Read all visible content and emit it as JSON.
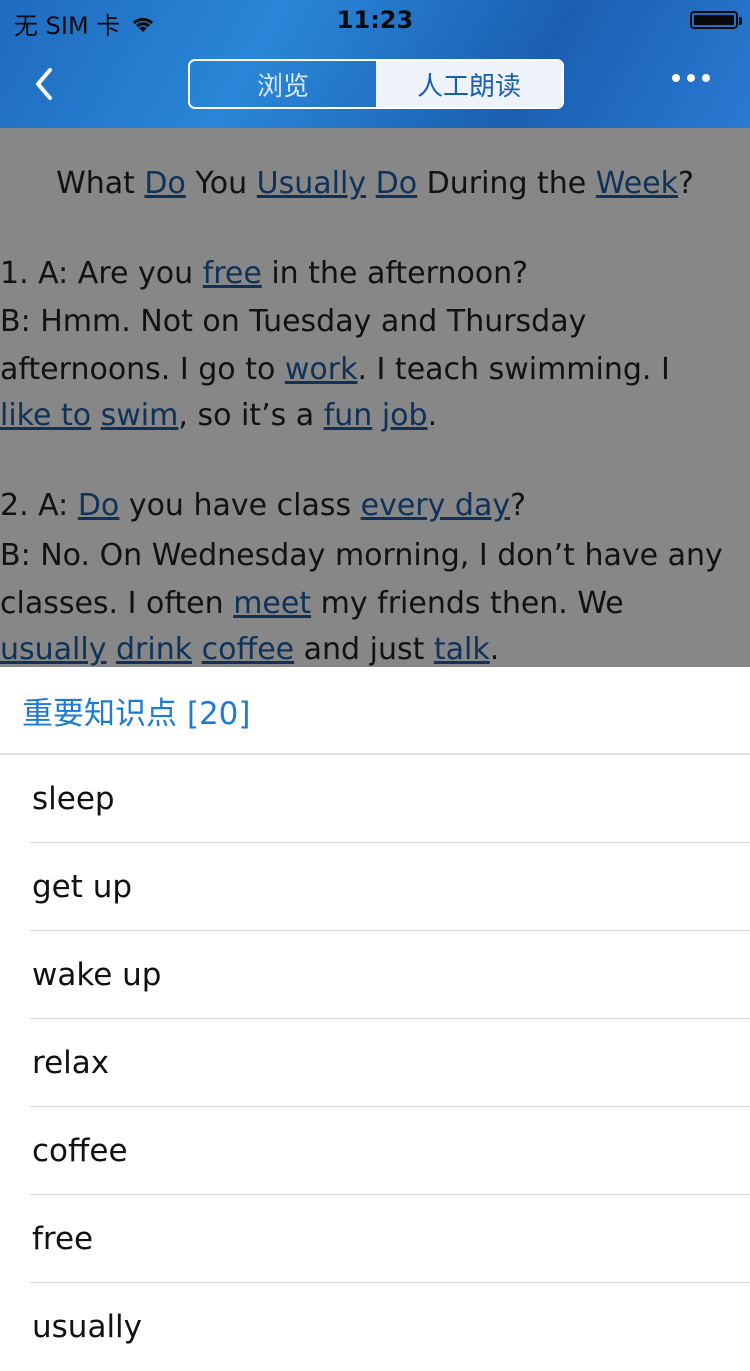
{
  "status": {
    "carrier": "无 SIM 卡",
    "time": "11:23"
  },
  "nav": {
    "tabs": [
      {
        "label": "浏览",
        "active": false
      },
      {
        "label": "人工朗读",
        "active": true
      }
    ],
    "icons": {
      "back": "chevron-left-icon",
      "more": "more-icon"
    }
  },
  "content": {
    "title_parts": [
      "What ",
      "Do",
      " You ",
      "Usually",
      " ",
      "Do",
      " During the ",
      "Week",
      "?"
    ],
    "p1_a": [
      "1. A: Are you ",
      "free",
      " in the afternoon?"
    ],
    "p1_b": "B: Hmm. Not on Tuesday and Thursday",
    "p1_c": [
      "afternoons. I go to ",
      "work",
      ". I teach swimming. I"
    ],
    "p1_d": [
      "like to",
      " ",
      "swim",
      ", so it’s a ",
      "fun",
      " ",
      "job",
      "."
    ],
    "p2_a": [
      "2. A: ",
      "Do",
      " you have class ",
      "every day",
      "?"
    ],
    "p2_b": "B: No. On Wednesday morning, I don’t have any",
    "p2_c": [
      "classes. I often ",
      "meet",
      " my friends then. We"
    ],
    "p2_d": [
      "usually",
      " ",
      "drink",
      " ",
      "coffee",
      " and just ",
      "talk",
      "."
    ]
  },
  "sheet": {
    "title": "重要知识点 [20]",
    "items": [
      "sleep",
      "get up",
      "wake up",
      "relax",
      "coffee",
      "free",
      "usually"
    ]
  },
  "colors": {
    "nav_blue": "#1f6bbf",
    "link_blue": "#1f5fa8",
    "sheet_title_blue": "#1e7bd4"
  }
}
